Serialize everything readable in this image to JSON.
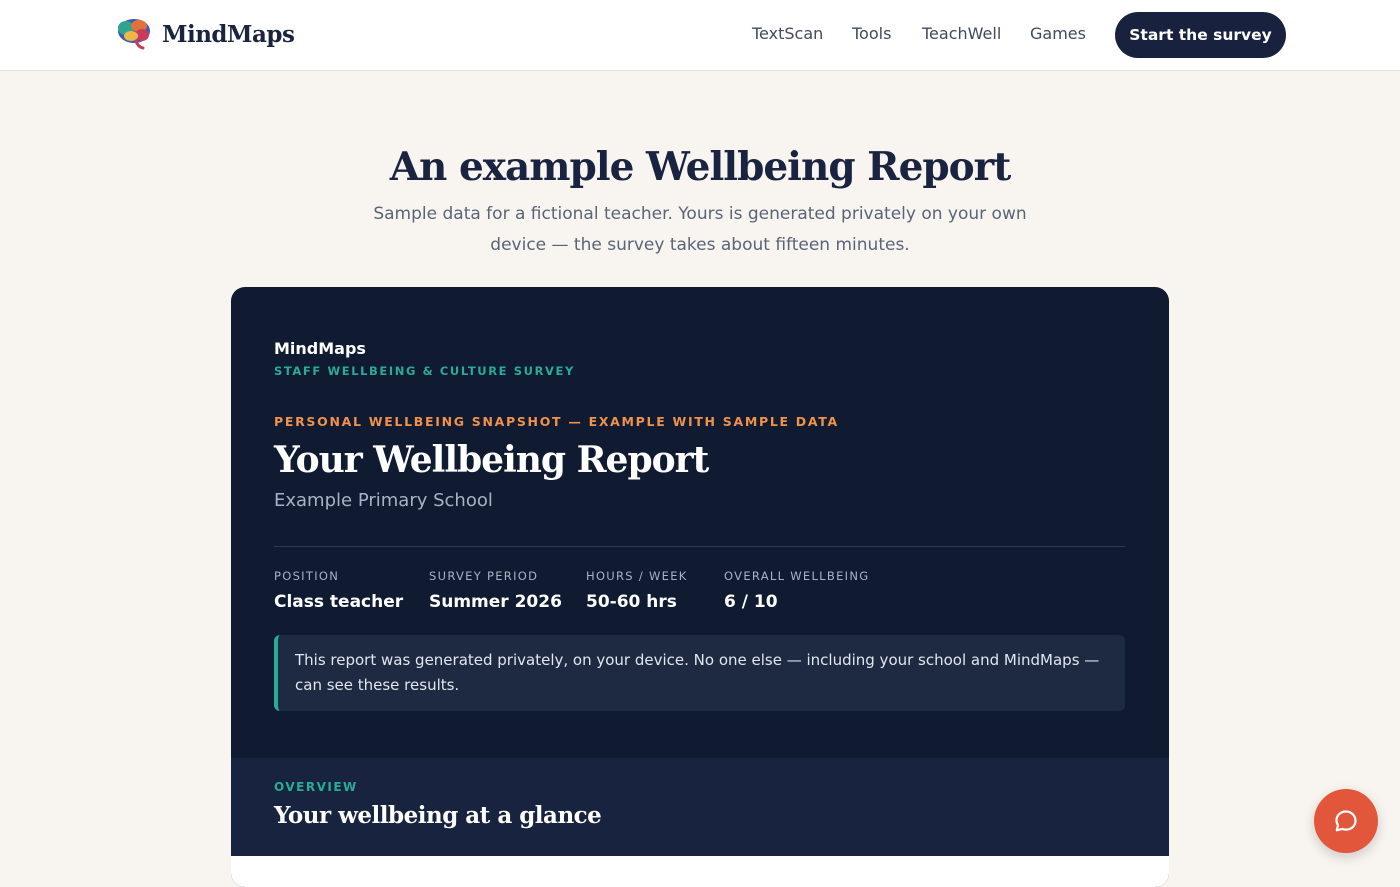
{
  "header": {
    "brand_name": "MindMaps",
    "nav": [
      {
        "label": "TextScan"
      },
      {
        "label": "Tools"
      },
      {
        "label": "TeachWell"
      },
      {
        "label": "Games"
      }
    ],
    "cta_label": "Start the survey"
  },
  "hero": {
    "title": "An example Wellbeing Report",
    "subtitle": "Sample data for a fictional teacher. Yours is generated privately on your own device — the survey takes about fifteen minutes."
  },
  "report": {
    "brand": "MindMaps",
    "survey_name": "STAFF WELLBEING & CULTURE SURVEY",
    "kicker": "PERSONAL WELLBEING SNAPSHOT — EXAMPLE WITH SAMPLE DATA",
    "title": "Your Wellbeing Report",
    "school": "Example Primary School",
    "stats": [
      {
        "label": "POSITION",
        "value": "Class teacher"
      },
      {
        "label": "SURVEY PERIOD",
        "value": "Summer 2026"
      },
      {
        "label": "HOURS / WEEK",
        "value": "50-60 hrs"
      },
      {
        "label": "OVERALL WELLBEING",
        "value": "6 / 10"
      }
    ],
    "privacy_notice": "This report was generated privately, on your device. No one else — including your school and MindMaps — can see these results.",
    "overview": {
      "label": "OVERVIEW",
      "title": "Your wellbeing at a glance"
    }
  },
  "colors": {
    "accent_teal": "#2bab96",
    "accent_orange": "#f0914c",
    "navy": "#101b31",
    "chat_button": "#e2563b"
  },
  "icons": {
    "logo": "brain-logo-icon",
    "chat": "chat-bubble-icon"
  }
}
